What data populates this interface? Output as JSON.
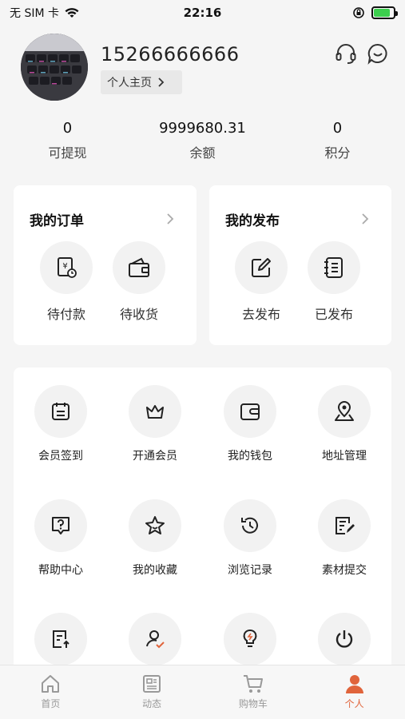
{
  "status_bar": {
    "carrier": "无 SIM 卡",
    "time": "22:16",
    "wifi_icon": "wifi-icon",
    "lock_icon": "orientation-lock-icon",
    "battery_level": 0.85,
    "battery_color": "#3ccf4e"
  },
  "profile": {
    "phone": "15266666666",
    "home_label": "个人主页",
    "icons": [
      "headset-icon",
      "chat-smile-icon"
    ]
  },
  "stats": [
    {
      "value": "0",
      "label": "可提现"
    },
    {
      "value": "9999680.31",
      "label": "余额"
    },
    {
      "value": "0",
      "label": "积分"
    }
  ],
  "orders": {
    "title": "我的订单",
    "items": [
      {
        "label": "待付款",
        "icon": "yen-receipt-icon"
      },
      {
        "label": "待收货",
        "icon": "wallet-card-icon"
      }
    ]
  },
  "publish": {
    "title": "我的发布",
    "items": [
      {
        "label": "去发布",
        "icon": "edit-icon"
      },
      {
        "label": "已发布",
        "icon": "notebook-icon"
      }
    ]
  },
  "services": [
    {
      "label": "会员签到",
      "icon": "calendar-icon"
    },
    {
      "label": "开通会员",
      "icon": "crown-icon"
    },
    {
      "label": "我的钱包",
      "icon": "wallet-icon"
    },
    {
      "label": "地址管理",
      "icon": "location-icon"
    },
    {
      "label": "帮助中心",
      "icon": "help-icon"
    },
    {
      "label": "我的收藏",
      "icon": "star-icon"
    },
    {
      "label": "浏览记录",
      "icon": "history-icon"
    },
    {
      "label": "素材提交",
      "icon": "document-edit-icon"
    },
    {
      "label": "",
      "icon": "document-upload-icon"
    },
    {
      "label": "",
      "icon": "user-check-icon"
    },
    {
      "label": "",
      "icon": "bulb-icon"
    },
    {
      "label": "",
      "icon": "power-icon"
    }
  ],
  "tabbar": {
    "accent": "#e0643b",
    "items": [
      {
        "label": "首页",
        "icon": "home-icon"
      },
      {
        "label": "动态",
        "icon": "news-icon"
      },
      {
        "label": "购物车",
        "icon": "cart-icon"
      },
      {
        "label": "个人",
        "icon": "person-icon",
        "active": true
      }
    ]
  }
}
